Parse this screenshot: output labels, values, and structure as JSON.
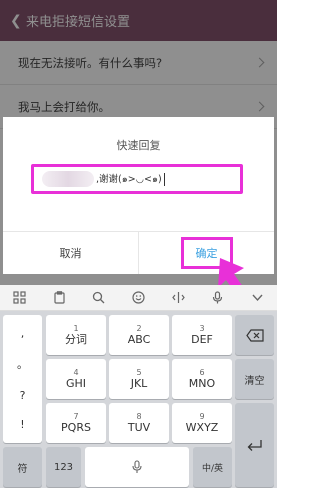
{
  "header": {
    "title": "来电拒接短信设置",
    "back_icon": "back-arrow-icon"
  },
  "list": {
    "items": [
      {
        "text": "现在无法接听。有什么事吗?"
      },
      {
        "text": "我马上会打给你。"
      }
    ]
  },
  "dialog": {
    "title": "快速回复",
    "input_value": ",谢谢(๑>◡<๑)",
    "cancel_label": "取消",
    "ok_label": "确定"
  },
  "toolbar": {
    "icons": [
      "grid-icon",
      "clipboard-icon",
      "search-icon",
      "emoji-icon",
      "cursor-icon",
      "microphone-icon",
      "collapse-keyboard-icon"
    ]
  },
  "keyboard": {
    "symbols": [
      ",",
      "。",
      "?",
      "!"
    ],
    "rows": [
      [
        {
          "sub": "1",
          "main": "分词"
        },
        {
          "sub": "2",
          "main": "ABC"
        },
        {
          "sub": "3",
          "main": "DEF"
        }
      ],
      [
        {
          "sub": "4",
          "main": "GHI"
        },
        {
          "sub": "5",
          "main": "JKL"
        },
        {
          "sub": "6",
          "main": "MNO"
        }
      ],
      [
        {
          "sub": "7",
          "main": "PQRS"
        },
        {
          "sub": "8",
          "main": "TUV"
        },
        {
          "sub": "9",
          "main": "WXYZ"
        }
      ]
    ],
    "backspace_icon": "backspace-icon",
    "clear_label": "清空",
    "enter_icon": "enter-icon",
    "symbol_label": "符",
    "number_label": "123",
    "space_mic_icon": "microphone-icon",
    "lang_label": "中/英"
  },
  "colors": {
    "header": "#84536e",
    "highlight": "#e830d8",
    "accent": "#3aa0e0"
  }
}
